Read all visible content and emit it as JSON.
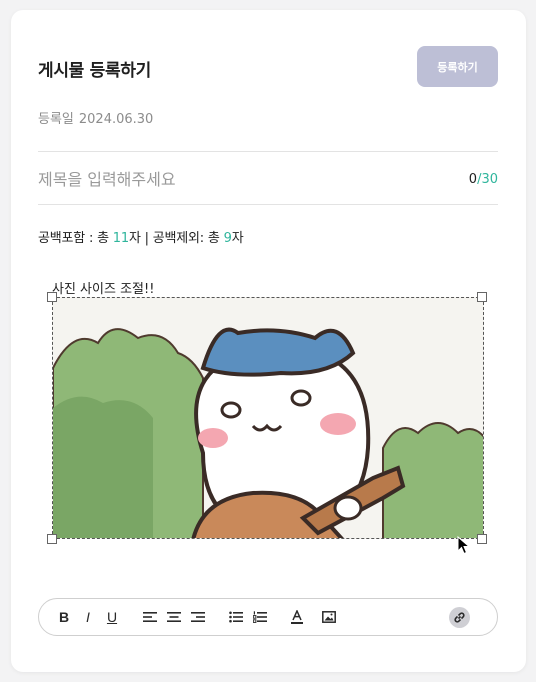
{
  "header": {
    "title": "게시물 등록하기",
    "submit_label": "등록하기"
  },
  "meta": {
    "date_label": "등록일",
    "date_value": "2024.06.30"
  },
  "title_field": {
    "placeholder": "제목을 입력해주세요",
    "value": "",
    "count_current": "0",
    "count_sep": "/",
    "count_max": "30"
  },
  "char_count": {
    "with_spaces_label": "공백포함 : 총 ",
    "with_spaces_value": "11",
    "with_spaces_unit": "자 | ",
    "without_spaces_label": "공백제외: 총 ",
    "without_spaces_value": "9",
    "without_spaces_unit": "자"
  },
  "editor": {
    "caption": "사진 사이즈 조절!!"
  },
  "toolbar": {
    "bold_label": "B",
    "italic_label": "I",
    "underline_label": "U",
    "icons": [
      "align-left-icon",
      "align-center-icon",
      "align-right-icon",
      "bullet-list-icon",
      "numbered-list-icon",
      "text-color-icon",
      "image-icon",
      "link-icon"
    ]
  },
  "colors": {
    "accent": "#2fb59c",
    "submit_disabled": "#bdbfd6",
    "muted_text": "#8c8c8c"
  }
}
